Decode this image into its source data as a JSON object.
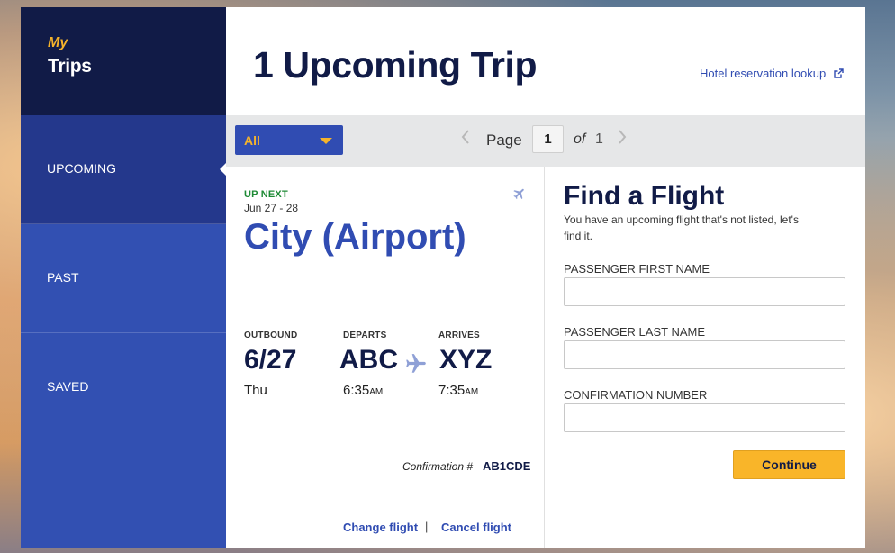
{
  "sidebar": {
    "brand_my": "My",
    "brand_trips": "Trips",
    "items": [
      {
        "label": "UPCOMING",
        "active": true
      },
      {
        "label": "PAST"
      },
      {
        "label": "SAVED"
      }
    ]
  },
  "header": {
    "title": "1 Upcoming Trip",
    "hotel_link": "Hotel reservation lookup"
  },
  "toolbar": {
    "filter_value": "All",
    "page_label": "Page",
    "page_value": "1",
    "of_label": "of",
    "total_pages": "1"
  },
  "trip": {
    "status": "UP NEXT",
    "dates": "Jun 27 - 28",
    "city": "City (Airport)",
    "outbound_label": "OUTBOUND",
    "outbound_date": "6/27",
    "outbound_day": "Thu",
    "departs_label": "DEPARTS",
    "departs_code": "ABC",
    "departs_time": "6:35",
    "departs_ampm": "AM",
    "arrives_label": "ARRIVES",
    "arrives_code": "XYZ",
    "arrives_time": "7:35",
    "arrives_ampm": "AM",
    "confirmation_label": "Confirmation #",
    "confirmation_number": "AB1CDE",
    "change_flight": "Change flight",
    "separator": "|",
    "cancel_flight": "Cancel flight"
  },
  "find_flight": {
    "title": "Find a Flight",
    "description": "You have an upcoming flight that's not listed, let's find it.",
    "first_name_label": "PASSENGER FIRST NAME",
    "first_name_value": "",
    "last_name_label": "PASSENGER LAST NAME",
    "last_name_value": "",
    "confirmation_label": "CONFIRMATION NUMBER",
    "confirmation_value": "",
    "continue_label": "Continue"
  },
  "colors": {
    "navy": "#111b47",
    "brand_blue": "#304cb2",
    "active_nav": "#24388c",
    "accent_yellow": "#f5b32b",
    "status_green": "#1e8a35"
  },
  "icons": [
    "external-link-icon",
    "chevron-left-icon",
    "chevron-right-icon",
    "airplane-icon",
    "caret-down-icon"
  ]
}
